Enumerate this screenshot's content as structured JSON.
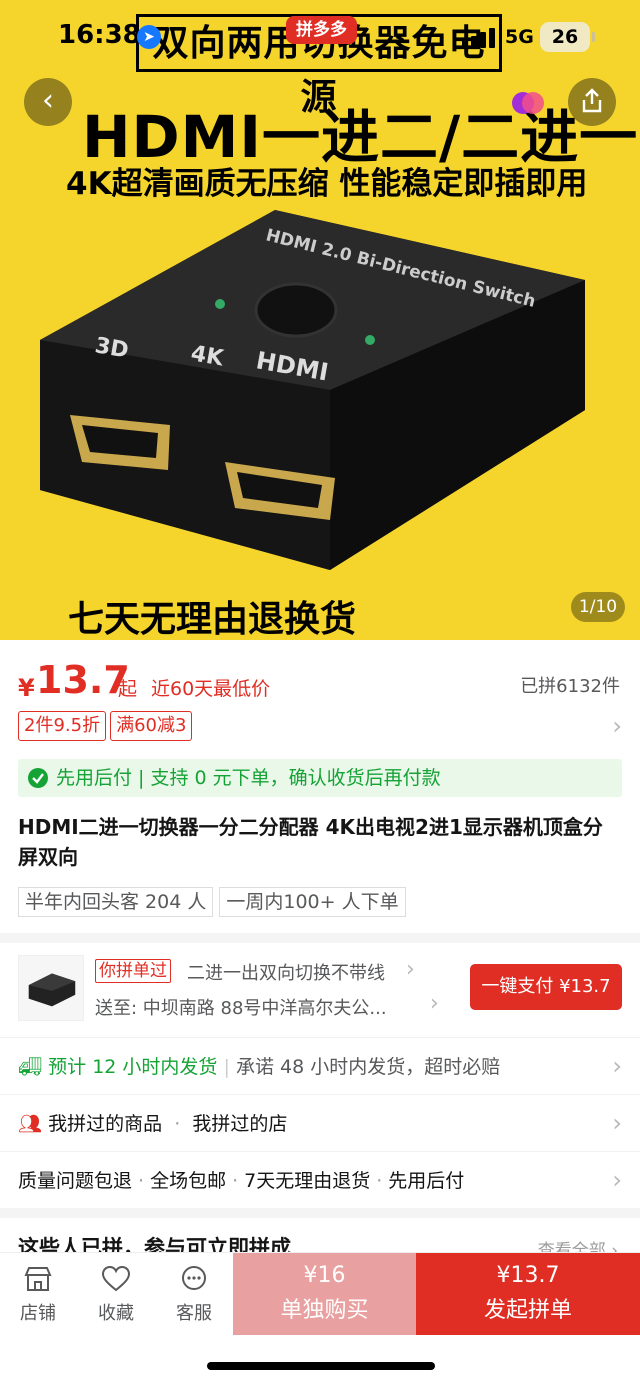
{
  "status_bar": {
    "time": "16:38",
    "network": "5G",
    "battery": "26"
  },
  "hero": {
    "banner": "双向两用切换器免电源",
    "app_badge": "拼多多",
    "headline": "HDMI一进二/二进一",
    "subline": "4K超清画质无压缩 性能稳定即插即用",
    "footer_text": "七天无理由退换货",
    "device_text": "HDMI 2.0 Bi-Direction Switch",
    "counter": "1/10"
  },
  "price": {
    "currency": "¥",
    "value": "13.7",
    "suffix": "起",
    "note": "近60天最低价",
    "sold": "已拼6132件"
  },
  "coupons": [
    "2件9.5折",
    "满60减3"
  ],
  "pay_later": "先用后付 | 支持 0 元下单，确认收货后再付款",
  "product_title": "HDMI二进一切换器一分二分配器 4K出电视2进1显示器机顶盒分屏双向",
  "tags": [
    "半年内回头客 204 人",
    "一周内100+ 人下单"
  ],
  "order_card": {
    "badge": "你拼单过",
    "product_name": "二进一出双向切换不带线",
    "address": "送至: 中坝南路 88号中洋高尔夫公...",
    "pay_button": "一键支付 ¥13.7"
  },
  "shipping": {
    "highlight": "预计 12 小时内发货",
    "promise": "承诺 48 小时内发货，超时必赔"
  },
  "history": {
    "item1": "我拼过的商品",
    "item2": "我拼过的店"
  },
  "services": [
    "质量问题包退",
    "全场包邮",
    "7天无理由退货",
    "先用后付"
  ],
  "group_teaser": {
    "title": "这些人已拼，参与可立即拼成",
    "more": "查看全部"
  },
  "bottom_nav": [
    {
      "label": "店铺",
      "icon": "store-icon"
    },
    {
      "label": "收藏",
      "icon": "heart-icon"
    },
    {
      "label": "客服",
      "icon": "chat-icon"
    }
  ],
  "buy_alone": {
    "price": "¥16",
    "label": "单独购买"
  },
  "buy_group": {
    "price": "¥13.7",
    "label": "发起拼单"
  },
  "colors": {
    "accent": "#e02e24",
    "green": "#16a336",
    "hero_bg": "#f5d52c"
  }
}
